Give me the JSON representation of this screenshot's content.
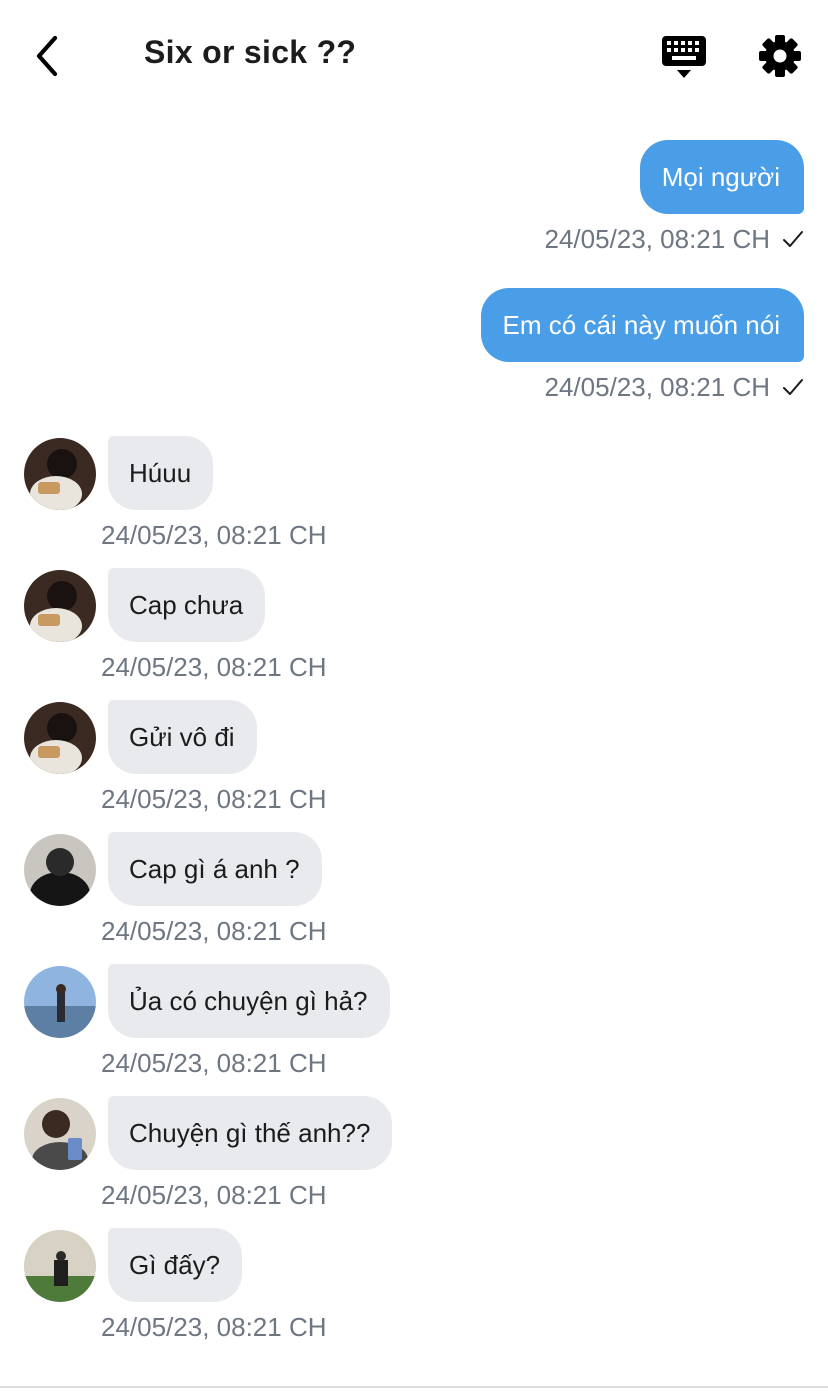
{
  "header": {
    "title": "Six or sick ??"
  },
  "outgoing": [
    {
      "text": "Mọi người",
      "time": "24/05/23, 08:21 CH",
      "status": "✓"
    },
    {
      "text": "Em có cái này muốn nói",
      "time": "24/05/23, 08:21 CH",
      "status": "✓"
    }
  ],
  "incoming": [
    {
      "text": "Húuu",
      "time": "24/05/23, 08:21 CH"
    },
    {
      "text": "Cap chưa",
      "time": "24/05/23, 08:21 CH"
    },
    {
      "text": "Gửi vô đi",
      "time": "24/05/23, 08:21 CH"
    },
    {
      "text": "Cap gì á anh ?",
      "time": "24/05/23, 08:21 CH"
    },
    {
      "text": "Ủa có chuyện gì hả?",
      "time": "24/05/23, 08:21 CH"
    },
    {
      "text": "Chuyện gì thế anh??",
      "time": "24/05/23, 08:21 CH"
    },
    {
      "text": "Gì đấy?",
      "time": "24/05/23, 08:21 CH"
    }
  ],
  "icons": {
    "back": "chevron-left-icon",
    "keyboard": "keyboard-hide-icon",
    "settings": "gear-icon",
    "read": "checkmark-icon"
  },
  "colors": {
    "outgoing_bubble": "#4a9ee8",
    "incoming_bubble": "#e8eaee",
    "timestamp": "#6e7681"
  }
}
